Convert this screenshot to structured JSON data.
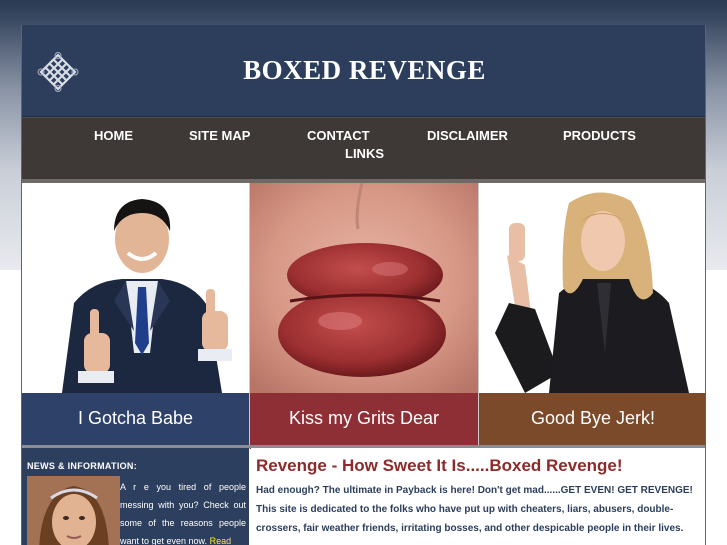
{
  "header": {
    "title": "BOXED REVENGE",
    "logo": "celtic-knot-icon"
  },
  "nav": {
    "items": [
      {
        "label": "HOME"
      },
      {
        "label": "SITE MAP"
      },
      {
        "label": "CONTACT"
      },
      {
        "label": "DISCLAIMER"
      },
      {
        "label": "PRODUCTS"
      },
      {
        "label": "LINKS"
      }
    ]
  },
  "panels": [
    {
      "caption": "I Gotcha Babe",
      "color": "#2d4169"
    },
    {
      "caption": "Kiss my Grits Dear",
      "color": "#8e2f36"
    },
    {
      "caption": "Good Bye Jerk!",
      "color": "#7a4a2a"
    }
  ],
  "sidebar": {
    "heading": "NEWS & INFORMATION:",
    "text": "A r e you tired of people messing with you? Check out some of the reasons people want to get even now.",
    "read_link": "Read"
  },
  "main": {
    "title": "Revenge - How Sweet It Is.....Boxed Revenge!",
    "line1": "Had enough? The ultimate in Payback is here! Don't get mad......GET EVEN! GET REVENGE!",
    "line2": "This site is dedicated to the folks who have put up with cheaters, liars, abusers, double-crossers, fair weather friends, irritating bosses, and other despicable people in their lives."
  },
  "colors": {
    "header_bg": "#2c3e5c",
    "nav_bg": "#3e3836",
    "title_red": "#8e2a2b",
    "body_text": "#2c3e5c",
    "read_link": "#ffe44a"
  }
}
